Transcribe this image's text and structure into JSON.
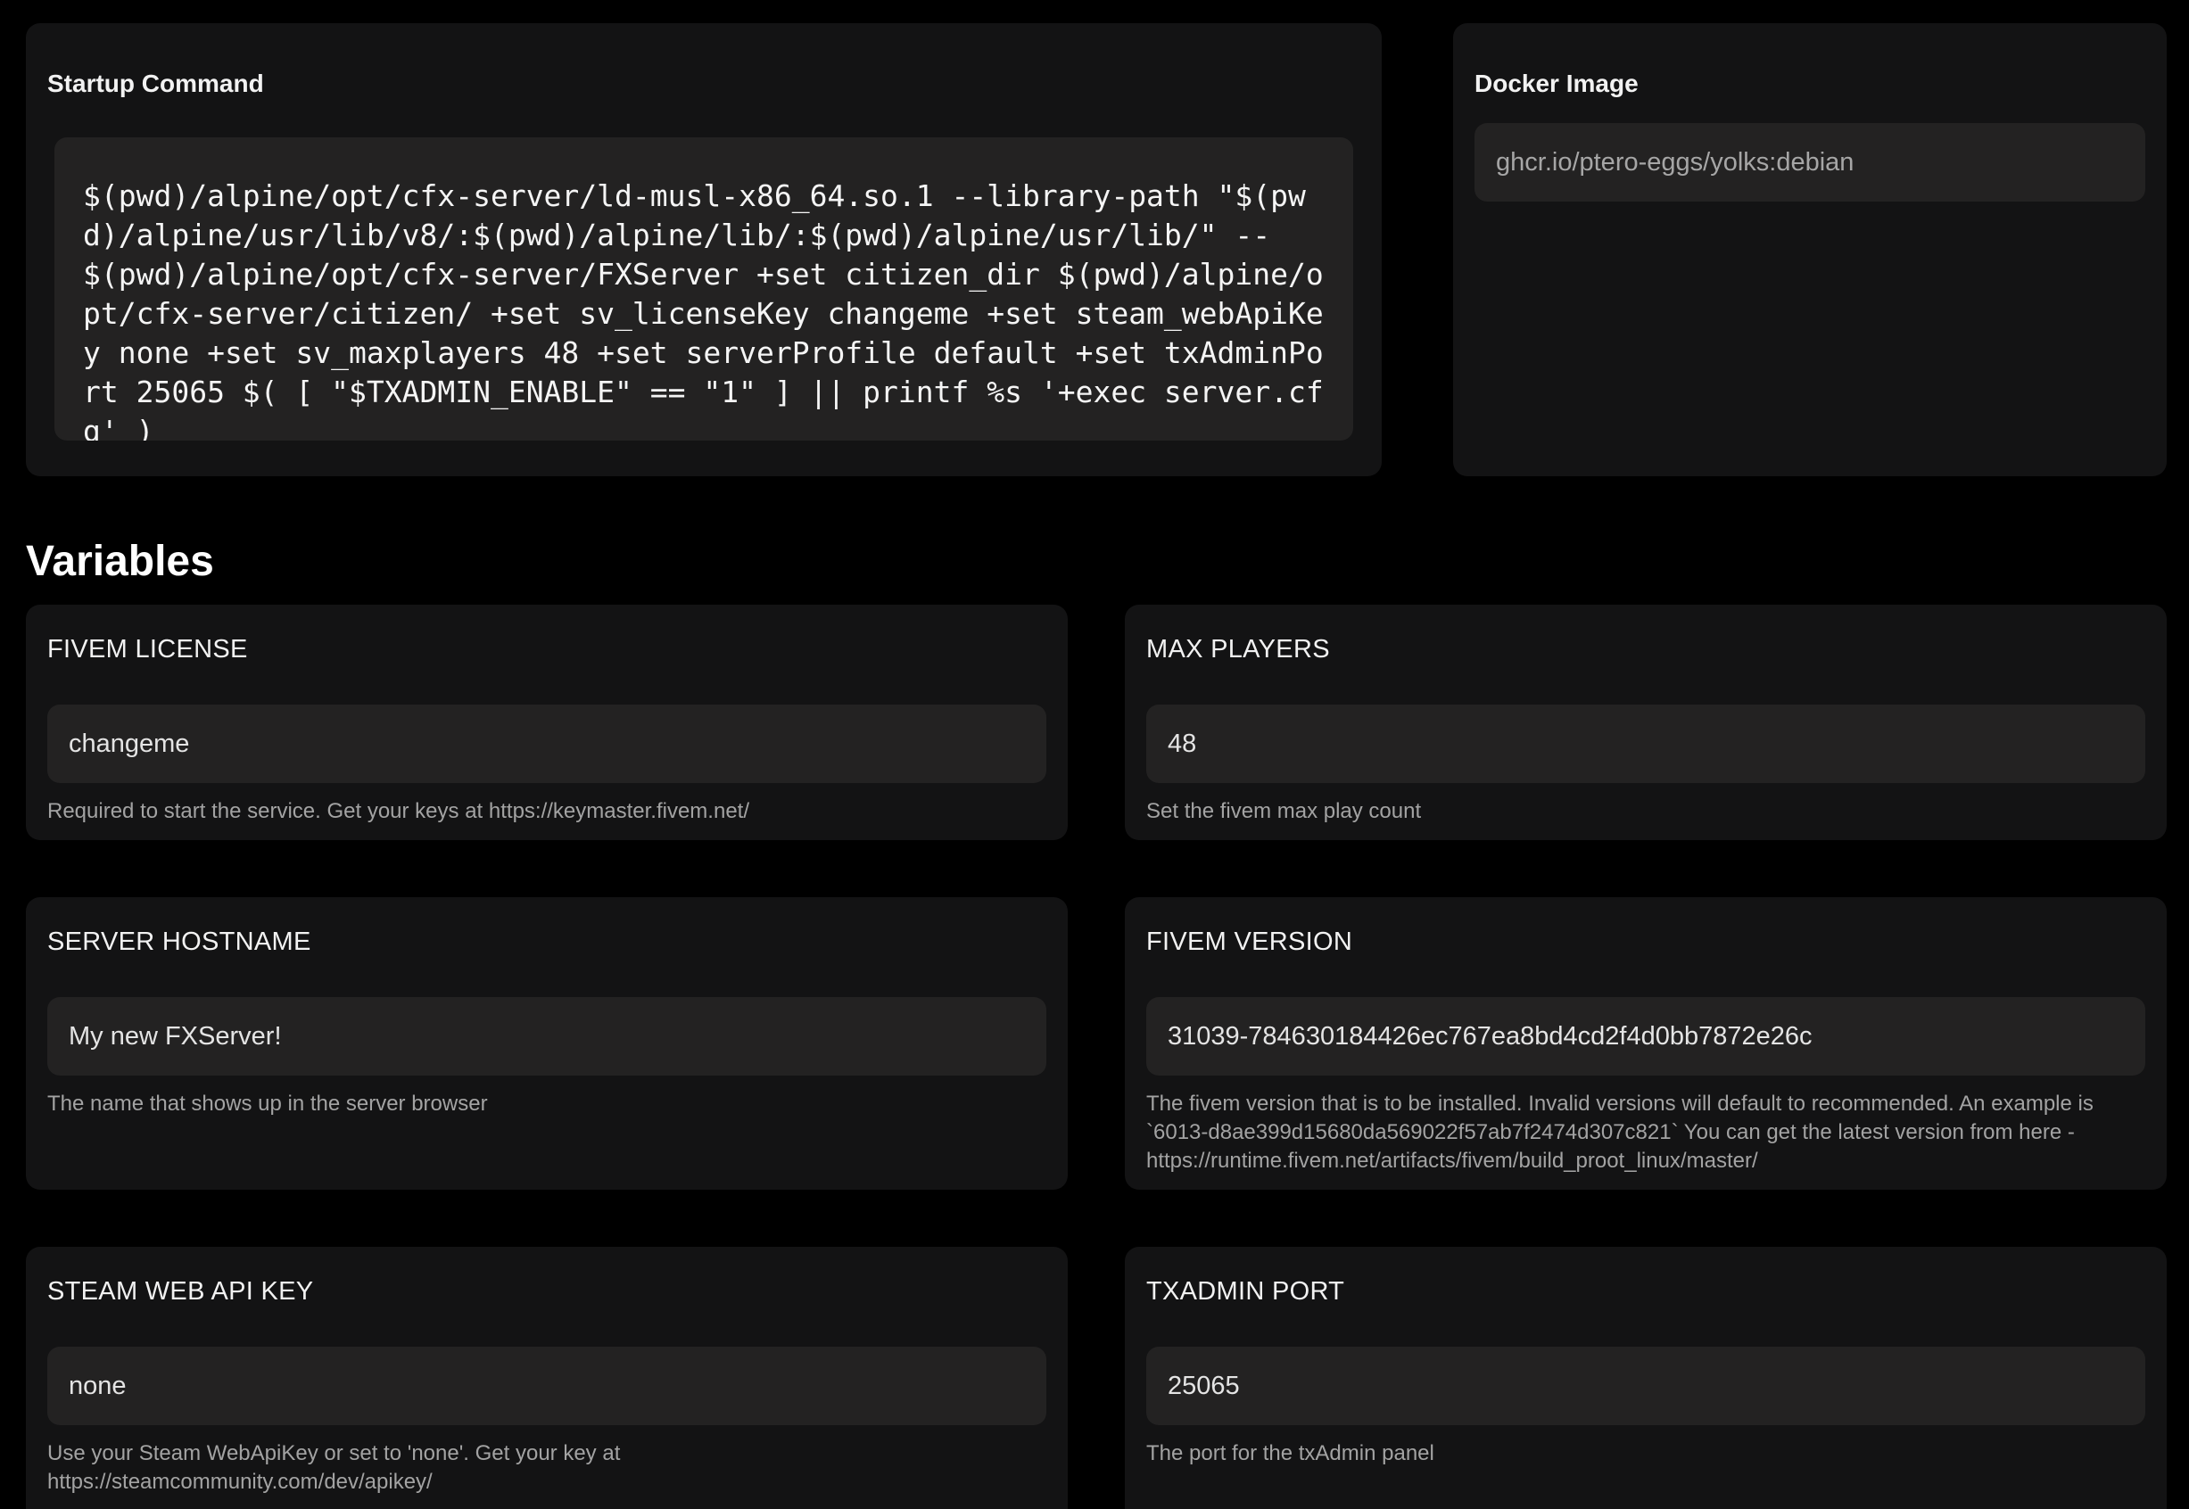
{
  "startup": {
    "title": "Startup Command",
    "command": "$(pwd)/alpine/opt/cfx-server/ld-musl-x86_64.so.1 --library-path \"$(pwd)/alpine/usr/lib/v8/:$(pwd)/alpine/lib/:$(pwd)/alpine/usr/lib/\" -- $(pwd)/alpine/opt/cfx-server/FXServer +set citizen_dir $(pwd)/alpine/opt/cfx-server/citizen/ +set sv_licenseKey changeme +set steam_webApiKey none +set sv_maxplayers 48 +set serverProfile default +set txAdminPort 25065 $( [ \"$TXADMIN_ENABLE\" == \"1\" ] || printf %s '+exec server.cfg' )"
  },
  "docker": {
    "title": "Docker Image",
    "image": "ghcr.io/ptero-eggs/yolks:debian"
  },
  "variables": {
    "heading": "Variables",
    "items": [
      {
        "label": "FIVEM LICENSE",
        "value": "changeme",
        "description": "Required to start the service. Get your keys at https://keymaster.fivem.net/"
      },
      {
        "label": "MAX PLAYERS",
        "value": "48",
        "description": "Set the fivem max play count"
      },
      {
        "label": "SERVER HOSTNAME",
        "value": "My new FXServer!",
        "description": "The name that shows up in the server browser"
      },
      {
        "label": "FIVEM VERSION",
        "value": "31039-784630184426ec767ea8bd4cd2f4d0bb7872e26c",
        "description": "The fivem version that is to be installed. Invalid versions will default to recommended. An example is `6013-d8ae399d15680da569022f57ab7f2474d307c821` You can get the latest version from here - https://runtime.fivem.net/artifacts/fivem/build_proot_linux/master/"
      },
      {
        "label": "STEAM WEB API KEY",
        "value": "none",
        "description": "Use your Steam WebApiKey or set to 'none'. Get your key at https://steamcommunity.com/dev/apikey/"
      },
      {
        "label": "TXADMIN PORT",
        "value": "25065",
        "description": "The port for the txAdmin panel"
      }
    ]
  }
}
